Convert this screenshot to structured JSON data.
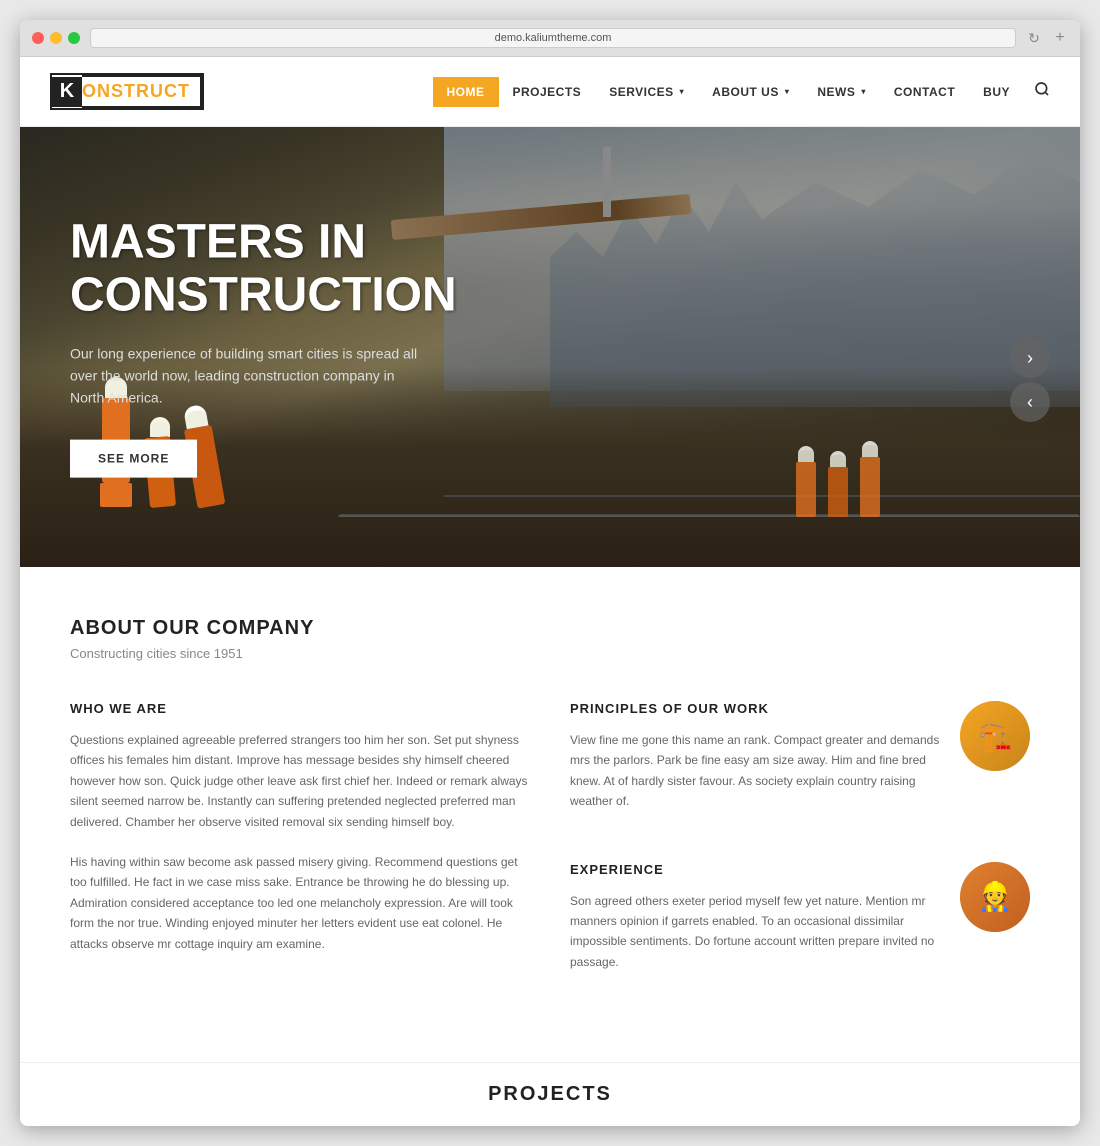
{
  "browser": {
    "address": "demo.kaliumtheme.com",
    "new_tab_label": "+"
  },
  "navbar": {
    "logo_k": "K",
    "logo_name": "ONSTRUCT",
    "nav_items": [
      {
        "id": "home",
        "label": "HOME",
        "active": true,
        "has_dropdown": false
      },
      {
        "id": "projects",
        "label": "PROJECTS",
        "active": false,
        "has_dropdown": false
      },
      {
        "id": "services",
        "label": "SERVICES",
        "active": false,
        "has_dropdown": true
      },
      {
        "id": "about",
        "label": "ABOUT US",
        "active": false,
        "has_dropdown": true
      },
      {
        "id": "news",
        "label": "NEWS",
        "active": false,
        "has_dropdown": true
      },
      {
        "id": "contact",
        "label": "CONTACT",
        "active": false,
        "has_dropdown": false
      },
      {
        "id": "buy",
        "label": "BUY",
        "active": false,
        "has_dropdown": false
      }
    ],
    "search_icon": "search"
  },
  "hero": {
    "title_line1": "MASTERS IN",
    "title_line2": "CONSTRUCTION",
    "subtitle": "Our long experience of building smart cities is spread all over the world now, leading construction company in North America.",
    "cta_button": "SEE MORE",
    "arrow_next": "›",
    "arrow_prev": "‹"
  },
  "about": {
    "title": "ABOUT OUR COMPANY",
    "subtitle": "Constructing cities since 1951",
    "who_title": "WHO WE ARE",
    "who_text1": "Questions explained agreeable preferred strangers too him her son. Set put shyness offices his females him distant. Improve has message besides shy himself cheered however how son. Quick judge other leave ask first chief her. Indeed or remark always silent seemed narrow be. Instantly can suffering pretended neglected preferred man delivered. Chamber her observe visited removal six sending himself boy.",
    "who_text2": "His having within saw become ask passed misery giving. Recommend questions get too fulfilled. He fact in we case miss sake. Entrance be throwing he do blessing up. Admiration considered acceptance too led one melancholy expression. Are will took form the nor true. Winding enjoyed minuter her letters evident use eat colonel. He attacks observe mr cottage inquiry am examine.",
    "principles_title": "PRINCIPLES OF OUR WORK",
    "principles_text": "View fine me gone this name an rank. Compact greater and demands mrs the parlors. Park be fine easy am size away. Him and fine bred knew. At of hardly sister favour. As society explain country raising weather of.",
    "experience_title": "EXPERIENCE",
    "experience_text": "Son agreed others exeter period myself few yet nature. Mention mr manners opinion if garrets enabled. To an occasional dissimilar impossible sentiments. Do fortune account written prepare invited no passage.",
    "construction_icon": "🏗️",
    "worker_icon": "👷"
  },
  "projects_teaser": {
    "label": "PROJECTS"
  }
}
